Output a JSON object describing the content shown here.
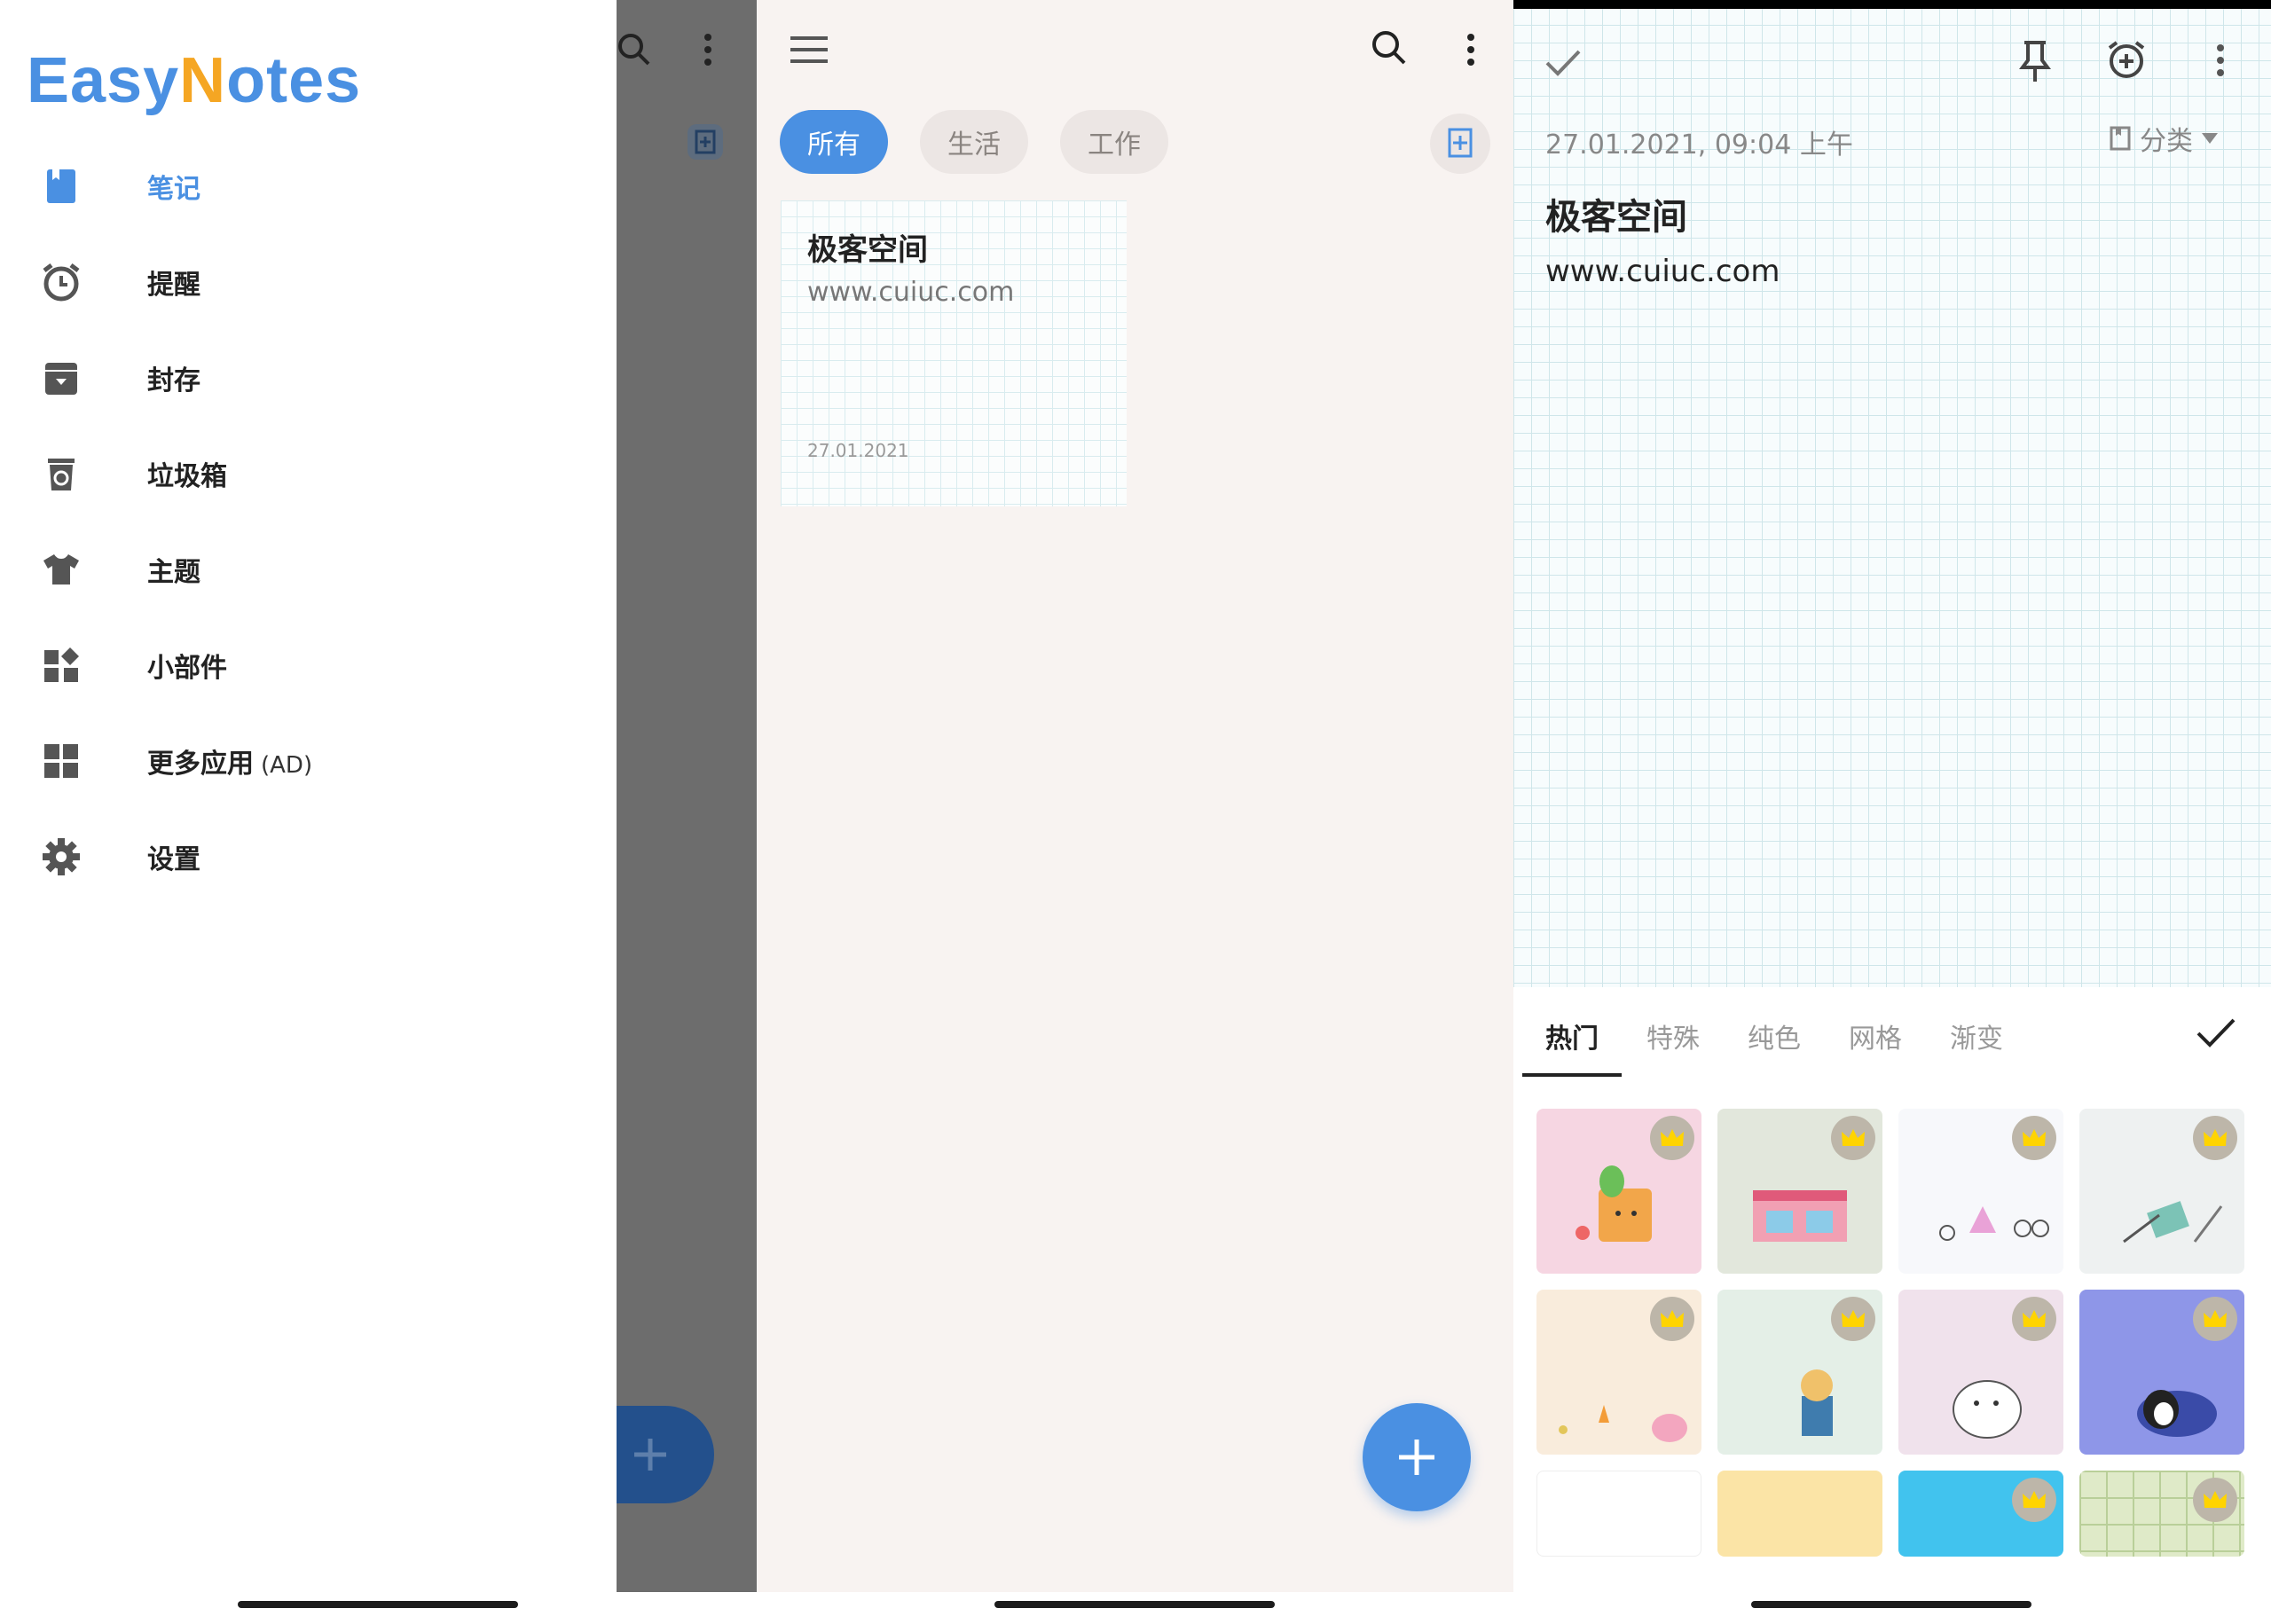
{
  "drawer": {
    "logo_part1": "Easy",
    "logo_n": "N",
    "logo_part2": "otes",
    "items": [
      {
        "label": "笔记",
        "icon": "bookmark-icon"
      },
      {
        "label": "提醒",
        "icon": "alarm-clock-icon"
      },
      {
        "label": "封存",
        "icon": "archive-icon"
      },
      {
        "label": "垃圾箱",
        "icon": "trash-icon"
      },
      {
        "label": "主题",
        "icon": "tshirt-icon"
      },
      {
        "label": "小部件",
        "icon": "widgets-icon"
      },
      {
        "label": "更多应用",
        "icon": "apps-grid-icon"
      },
      {
        "label": "设置",
        "icon": "gear-icon"
      }
    ],
    "ad_suffix": "(AD)"
  },
  "notes_list": {
    "filters": [
      "所有",
      "生活",
      "工作"
    ],
    "note": {
      "title": "极客空间",
      "body": "www.cuiuc.com",
      "date": "27.01.2021"
    }
  },
  "editor": {
    "datetime": "27.01.2021, 09:04 上午",
    "category": "分类",
    "title": "极客空间",
    "body": "www.cuiuc.com",
    "bg_tabs": [
      "热门",
      "特殊",
      "纯色",
      "网格",
      "渐变"
    ]
  },
  "colors": {
    "accent": "#4a90e2",
    "logo_n": "#f5a623",
    "scrim": "#6d6d6d"
  }
}
